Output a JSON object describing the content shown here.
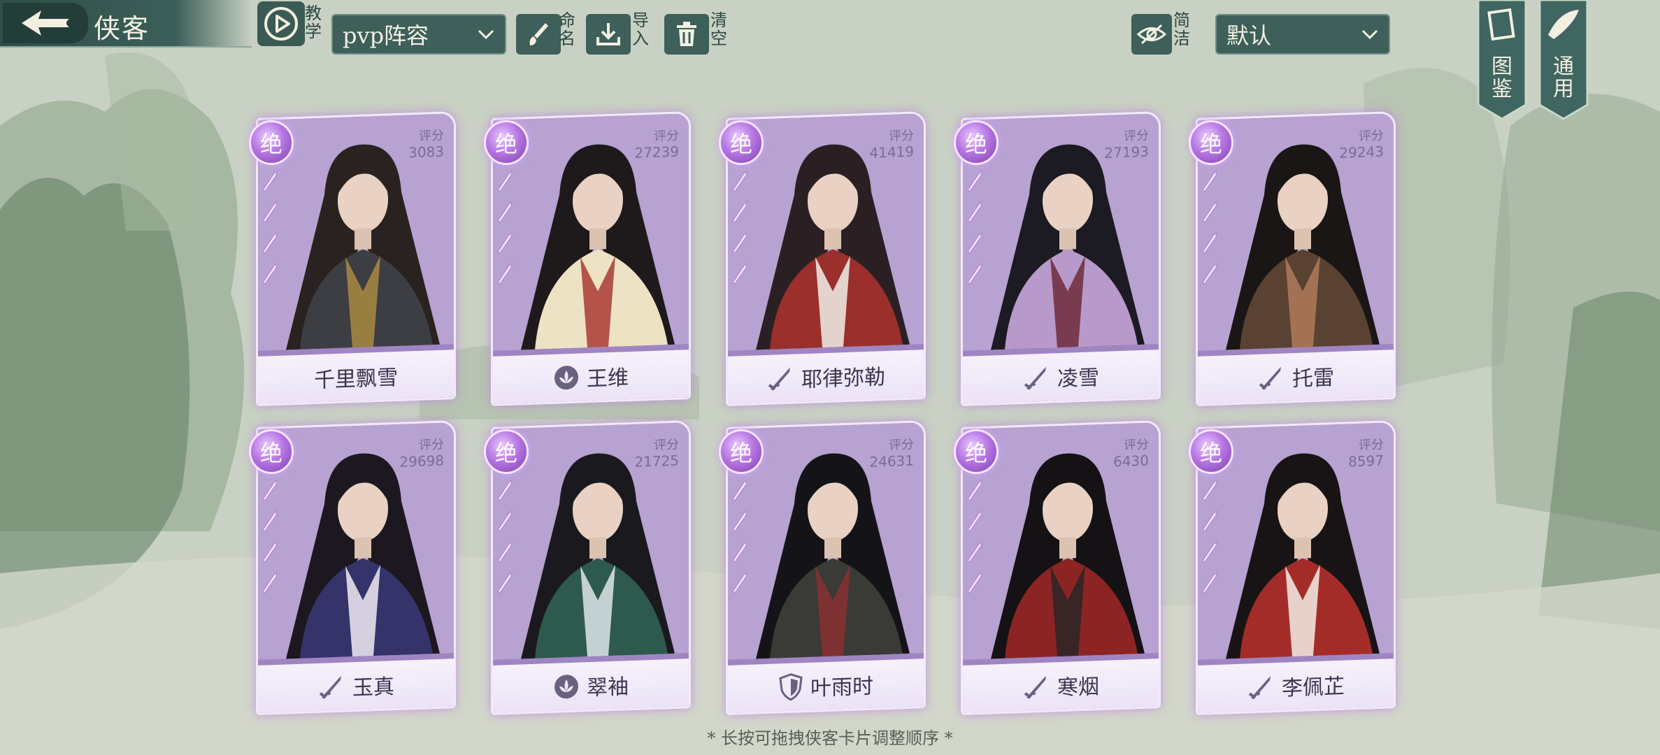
{
  "header": {
    "title": "侠客",
    "tutorial_label": "教学",
    "lineup_select": "pvp阵容",
    "rename_label": "命名",
    "import_label": "导入",
    "clear_label": "清空",
    "simple_label": "简洁",
    "sort_select": "默认",
    "codex_label": "图鉴",
    "general_label": "通用"
  },
  "cards": [
    {
      "rank": "绝",
      "score_label": "评分",
      "score": "3083",
      "name": "千里飘雪",
      "type_icon": "none",
      "hair": "#2a2220",
      "robe": "#3d3e43",
      "accent": "#a98a42"
    },
    {
      "rank": "绝",
      "score_label": "评分",
      "score": "27239",
      "name": "王维",
      "type_icon": "lotus-icon",
      "hair": "#1e1a1c",
      "robe": "#eee2c5",
      "accent": "#a83a32"
    },
    {
      "rank": "绝",
      "score_label": "评分",
      "score": "41419",
      "name": "耶律弥勒",
      "type_icon": "sword-icon",
      "hair": "#2a2024",
      "robe": "#9a2f2c",
      "accent": "#f1efe9"
    },
    {
      "rank": "绝",
      "score_label": "评分",
      "score": "27193",
      "name": "凌雪",
      "type_icon": "sword-icon",
      "hair": "#1c1a22",
      "robe": "#b79ac9",
      "accent": "#6e2a3a"
    },
    {
      "rank": "绝",
      "score_label": "评分",
      "score": "29243",
      "name": "托雷",
      "type_icon": "sword-icon",
      "hair": "#1a1616",
      "robe": "#5a4232",
      "accent": "#b07a5a"
    },
    {
      "rank": "绝",
      "score_label": "评分",
      "score": "29698",
      "name": "玉真",
      "type_icon": "sword-icon",
      "hair": "#1d1820",
      "robe": "#34336a",
      "accent": "#f2ecf3"
    },
    {
      "rank": "绝",
      "score_label": "评分",
      "score": "21725",
      "name": "翠袖",
      "type_icon": "lotus-icon",
      "hair": "#1a1a1e",
      "robe": "#2d5a4c",
      "accent": "#dfe6ea"
    },
    {
      "rank": "绝",
      "score_label": "评分",
      "score": "24631",
      "name": "叶雨时",
      "type_icon": "shield-icon",
      "hair": "#141418",
      "robe": "#3a3a36",
      "accent": "#8a3030"
    },
    {
      "rank": "绝",
      "score_label": "评分",
      "score": "6430",
      "name": "寒烟",
      "type_icon": "sword-icon",
      "hair": "#141214",
      "robe": "#8c2424",
      "accent": "#2a2626"
    },
    {
      "rank": "绝",
      "score_label": "评分",
      "score": "8597",
      "name": "李佩芷",
      "type_icon": "sword-icon",
      "hair": "#181416",
      "robe": "#a42c28",
      "accent": "#f4efe6"
    }
  ],
  "footer": {
    "hint": "* 长按可拖拽侠客卡片调整顺序 *"
  }
}
